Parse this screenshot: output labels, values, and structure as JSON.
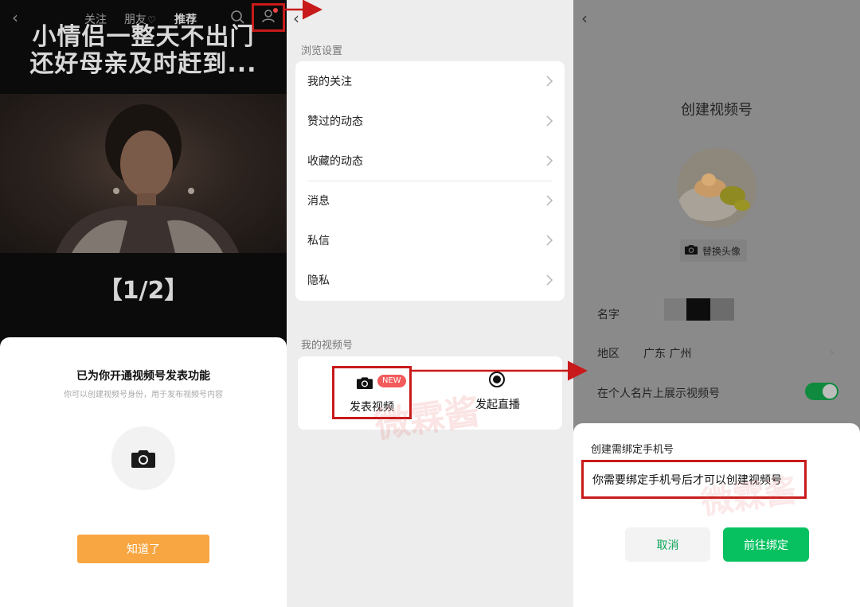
{
  "colors": {
    "highlight": "#c81a1a",
    "orange_button": "#f8a641",
    "wechat_green": "#07c160",
    "new_badge": "#f25c5c"
  },
  "panel1": {
    "nav": {
      "back_icon": "chevron-left-icon",
      "tabs": [
        "关注",
        "朋友",
        "推荐"
      ],
      "friends_icon": "heart-icon",
      "search_icon": "search-icon",
      "profile_icon": "profile-icon"
    },
    "video_title_line1": "小情侣一整天不出门",
    "video_title_line2": "还好母亲及时赶到...",
    "page_counter": "【1/2】",
    "sheet": {
      "title": "已为你开通视频号发表功能",
      "subtitle": "你可以创建视频号身份，用于发布视频号内容",
      "icon": "camera-icon",
      "ok_button": "知道了"
    }
  },
  "panel2": {
    "back_icon": "chevron-left-icon",
    "section_browse": "浏览设置",
    "menu_items": [
      "我的关注",
      "赞过的动态",
      "收藏的动态",
      "消息",
      "私信",
      "隐私"
    ],
    "section_channel": "我的视频号",
    "post_video": {
      "label": "发表视频",
      "badge": "NEW",
      "icon": "camera-icon"
    },
    "start_live": {
      "label": "发起直播",
      "icon": "live-record-icon"
    }
  },
  "panel3": {
    "back_icon": "chevron-left-icon",
    "title": "创建视频号",
    "change_avatar": "替换头像",
    "name_label": "名字",
    "region_label": "地区",
    "region_value": "广东 广州",
    "show_on_card_label": "在个人名片上展示视频号",
    "show_on_card_enabled": true,
    "dialog": {
      "title": "创建需绑定手机号",
      "message": "你需要绑定手机号后才可以创建视频号",
      "cancel": "取消",
      "confirm": "前往绑定"
    }
  }
}
